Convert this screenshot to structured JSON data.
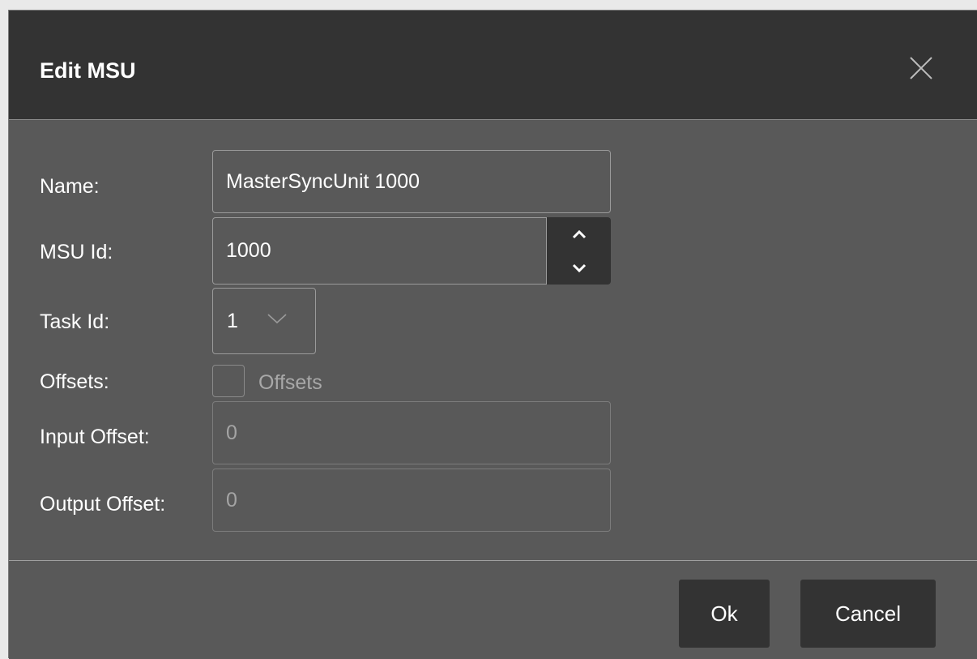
{
  "dialog": {
    "title": "Edit MSU",
    "close_icon": "close-icon"
  },
  "form": {
    "name_label": "Name:",
    "name_value": "MasterSyncUnit 1000",
    "msu_id_label": "MSU Id:",
    "msu_id_value": "1000",
    "spin_up_icon": "chevron-up-icon",
    "spin_down_icon": "chevron-down-icon",
    "task_id_label": "Task Id:",
    "task_id_value": "1",
    "task_id_dropdown_icon": "chevron-down-icon",
    "offsets_label": "Offsets:",
    "offsets_checkbox_label": "Offsets",
    "offsets_checked": false,
    "input_offset_label": "Input Offset:",
    "input_offset_value": "0",
    "output_offset_label": "Output Offset:",
    "output_offset_value": "0"
  },
  "footer": {
    "ok_label": "Ok",
    "cancel_label": "Cancel"
  },
  "colors": {
    "dialog_bg": "#595959",
    "header_bg": "#333333",
    "button_bg": "#333333",
    "text": "#ffffff",
    "disabled_text": "#a4a4a4"
  }
}
